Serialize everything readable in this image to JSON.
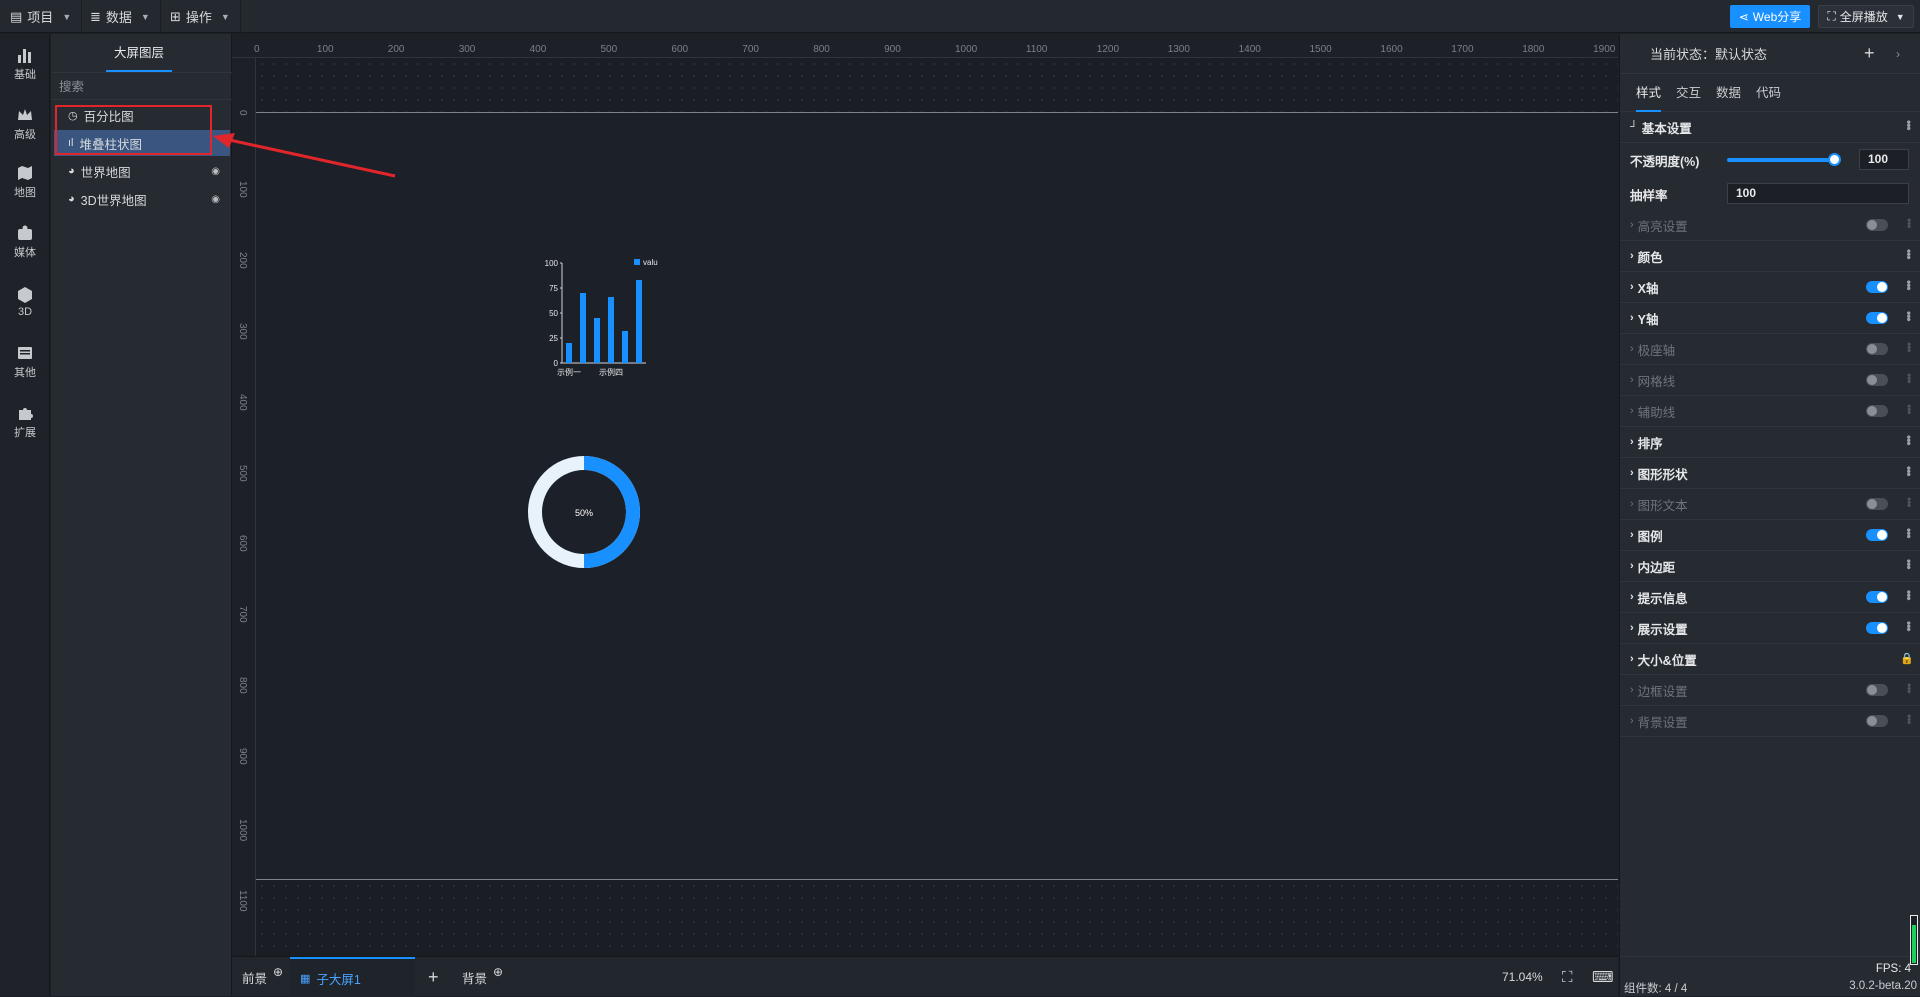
{
  "topbar": {
    "project": "项目",
    "data": "数据",
    "operation": "操作",
    "share": "Web分享",
    "fullscreen": "全屏播放"
  },
  "rail": [
    "基础",
    "高级",
    "地图",
    "媒体",
    "3D",
    "其他",
    "扩展"
  ],
  "layers": {
    "tab": "大屏图层",
    "search_placeholder": "搜索",
    "items": [
      {
        "label": "百分比图"
      },
      {
        "label": "堆叠柱状图"
      },
      {
        "label": "世界地图"
      },
      {
        "label": "3D世界地图"
      }
    ]
  },
  "ruler": {
    "h": [
      "0",
      "100",
      "200",
      "300",
      "400",
      "500",
      "600",
      "700",
      "800",
      "900",
      "1000",
      "1100",
      "1200",
      "1300",
      "1400",
      "1500",
      "1600",
      "1700",
      "1800",
      "1900"
    ],
    "v": [
      "0",
      "100",
      "200",
      "300",
      "400",
      "500",
      "600",
      "700",
      "800",
      "900",
      "1000",
      "1100"
    ]
  },
  "chart_data": {
    "type": "bar",
    "legend": [
      "value"
    ],
    "categories": [
      "示例一",
      "",
      "",
      "示例四",
      "",
      ""
    ],
    "values": [
      20,
      70,
      45,
      66,
      32,
      83
    ],
    "ylim": [
      0,
      100
    ],
    "yticks": [
      "0",
      "25",
      "50",
      "75",
      "100"
    ],
    "series": [
      {
        "name": "value",
        "values": [
          20,
          70,
          45,
          66,
          32,
          83
        ]
      }
    ],
    "color": "#1890ff"
  },
  "donut": {
    "label": "50%",
    "value": 50,
    "color": "#1890ff",
    "track": "#e8f2fb"
  },
  "bottombar": {
    "foreground": "前景",
    "active_tab": "子大屏1",
    "background": "背景",
    "zoom": "71.04%"
  },
  "right": {
    "state": "当前状态：默认状态",
    "tabs": [
      "样式",
      "交互",
      "数据",
      "代码"
    ],
    "basic": "基本设置",
    "opacity_label": "不透明度(%)",
    "opacity_value": "100",
    "sampling_label": "抽样率",
    "sampling_value": "100",
    "sections": [
      {
        "label": "高亮设置",
        "dim": true,
        "toggle": "off"
      },
      {
        "label": "颜色",
        "dim": false,
        "toggle": "none"
      },
      {
        "label": "X轴",
        "dim": false,
        "toggle": "on"
      },
      {
        "label": "Y轴",
        "dim": false,
        "toggle": "on"
      },
      {
        "label": "极座轴",
        "dim": true,
        "toggle": "off"
      },
      {
        "label": "网格线",
        "dim": true,
        "toggle": "off"
      },
      {
        "label": "辅助线",
        "dim": true,
        "toggle": "off"
      },
      {
        "label": "排序",
        "dim": false,
        "toggle": "none"
      },
      {
        "label": "图形形状",
        "dim": false,
        "toggle": "none"
      },
      {
        "label": "图形文本",
        "dim": true,
        "toggle": "off"
      },
      {
        "label": "图例",
        "dim": false,
        "toggle": "on"
      },
      {
        "label": "内边距",
        "dim": false,
        "toggle": "none"
      },
      {
        "label": "提示信息",
        "dim": false,
        "toggle": "on"
      },
      {
        "label": "展示设置",
        "dim": false,
        "toggle": "on"
      },
      {
        "label": "大小&位置",
        "dim": false,
        "toggle": "lock"
      },
      {
        "label": "边框设置",
        "dim": true,
        "toggle": "off"
      },
      {
        "label": "背景设置",
        "dim": true,
        "toggle": "off"
      }
    ],
    "fps": "FPS: 4",
    "component_count": "组件数: 4 / 4",
    "version": "3.0.2-beta.20"
  },
  "colors": {
    "accent": "#1890ff",
    "highlight": "#e0262b",
    "selected_row": "#3a5680"
  }
}
